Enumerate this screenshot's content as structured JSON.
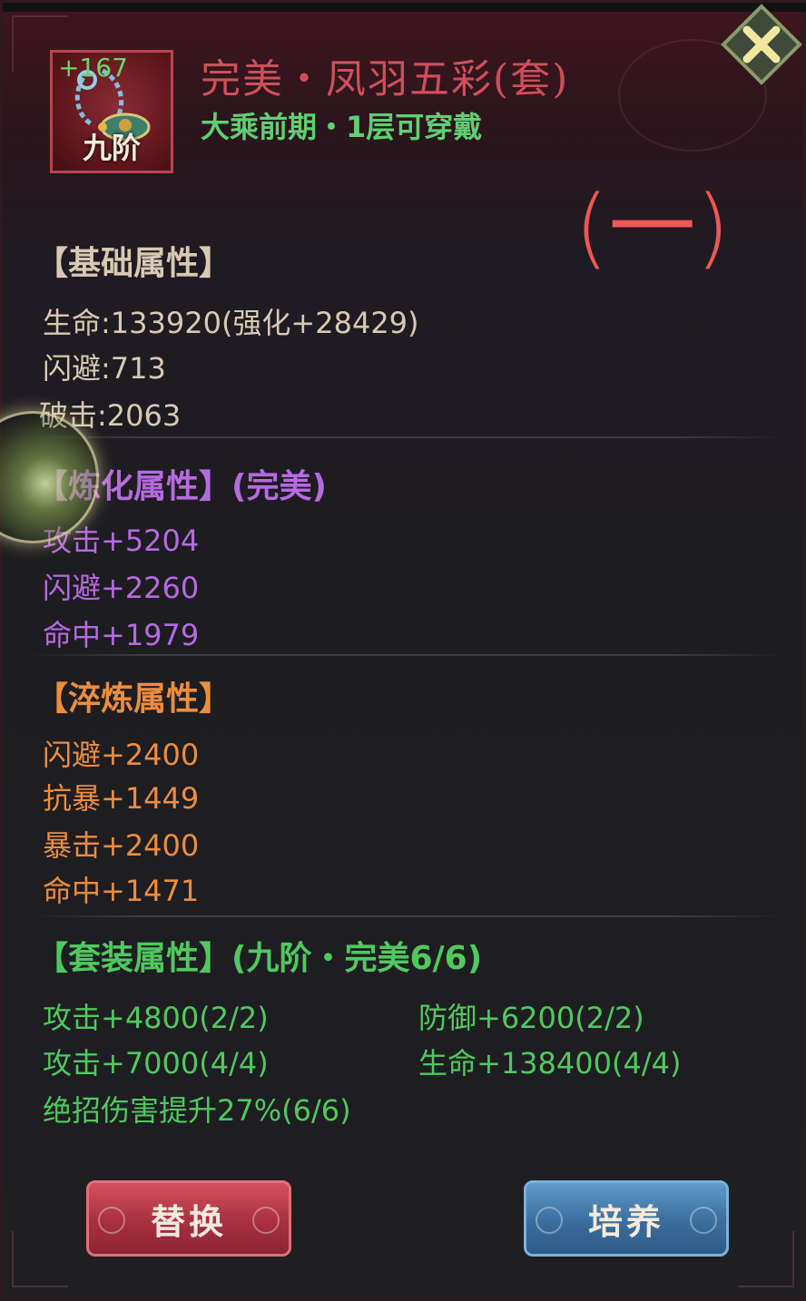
{
  "item": {
    "enhance": "+167",
    "grade": "九阶",
    "name": "完美・凤羽五彩(套)",
    "requirement": "大乘前期・1层可穿戴"
  },
  "annotation": "(一)",
  "base": {
    "title": "【基础属性】",
    "lines": [
      "生命:133920(强化+28429)",
      "闪避:713",
      "破击:2063"
    ]
  },
  "refine": {
    "title": "【炼化属性】",
    "quality": "(完美)",
    "lines": [
      "攻击+5204",
      "闪避+2260",
      "命中+1979"
    ]
  },
  "temper": {
    "title": "【淬炼属性】",
    "lines": [
      "闪避+2400",
      "抗暴+1449",
      "暴击+2400",
      "命中+1471"
    ]
  },
  "set": {
    "title": "【套装属性】(九阶・完美6/6)",
    "left": [
      "攻击+4800(2/2)",
      "攻击+7000(4/4)",
      "绝招伤害提升27%(6/6)"
    ],
    "right": [
      "防御+6200(2/2)",
      "生命+138400(4/4)"
    ]
  },
  "buttons": {
    "replace": "替换",
    "train": "培养"
  },
  "colors": {
    "name": "#cf4f58",
    "requirement": "#5fcf72",
    "base": "#d8c9b2",
    "refine": "#b66adf",
    "temper": "#ec8d3e",
    "set": "#4fc95e",
    "annotation": "#ef5656"
  },
  "icons": {
    "close": "close-icon",
    "item": "necklace-icon"
  }
}
